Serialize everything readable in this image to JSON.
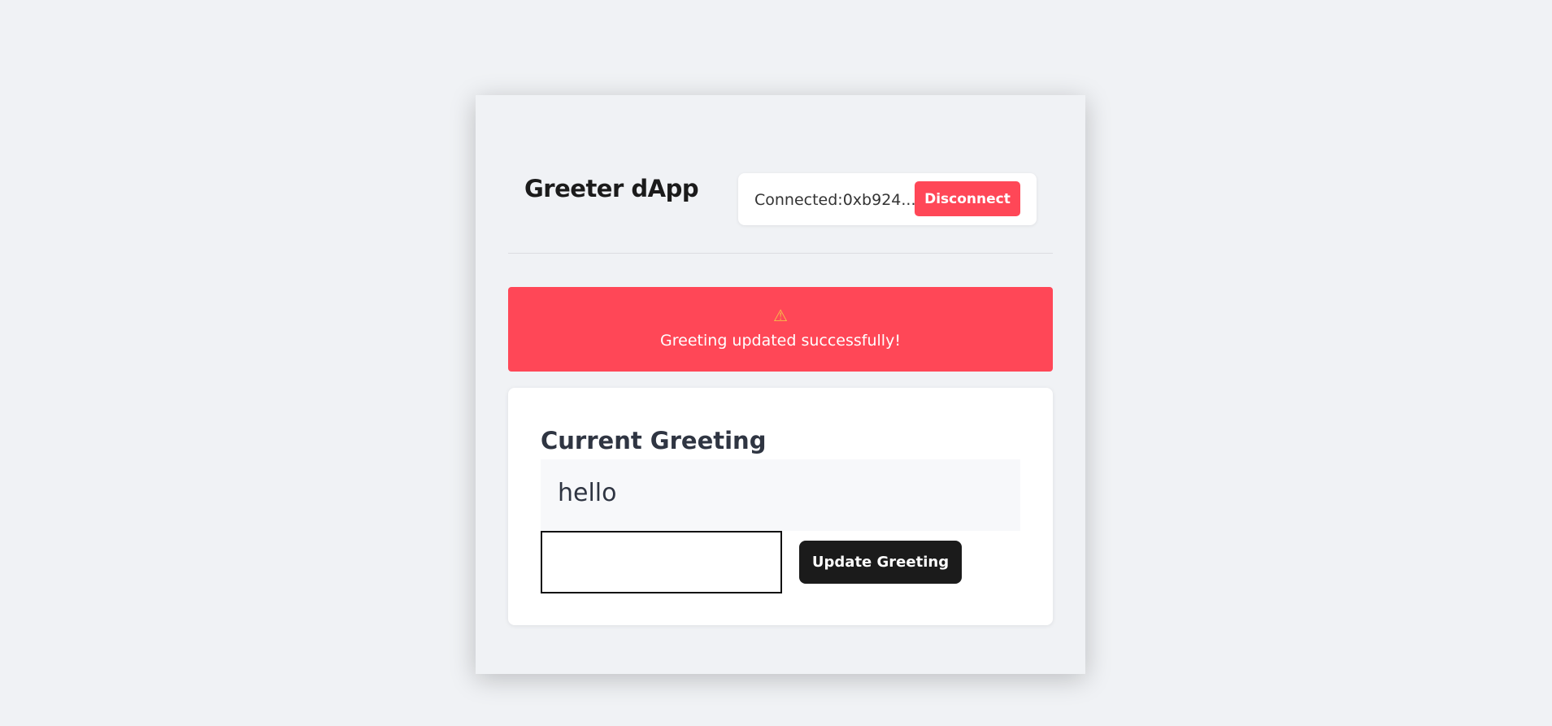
{
  "app": {
    "title": "Greeter dApp"
  },
  "wallet": {
    "status_text": "Connected:0xb924...",
    "disconnect_label": "Disconnect"
  },
  "alert": {
    "icon": "warning-icon",
    "icon_glyph": "⚠",
    "message": "Greeting updated successfully!"
  },
  "greeting": {
    "heading": "Current Greeting",
    "current_value": "hello",
    "input_value": "",
    "update_label": "Update Greeting"
  },
  "colors": {
    "page_background": "#f0f2f5",
    "accent_red": "#ff4757",
    "dark_button": "#1b1b1b",
    "card_background": "#ffffff"
  }
}
